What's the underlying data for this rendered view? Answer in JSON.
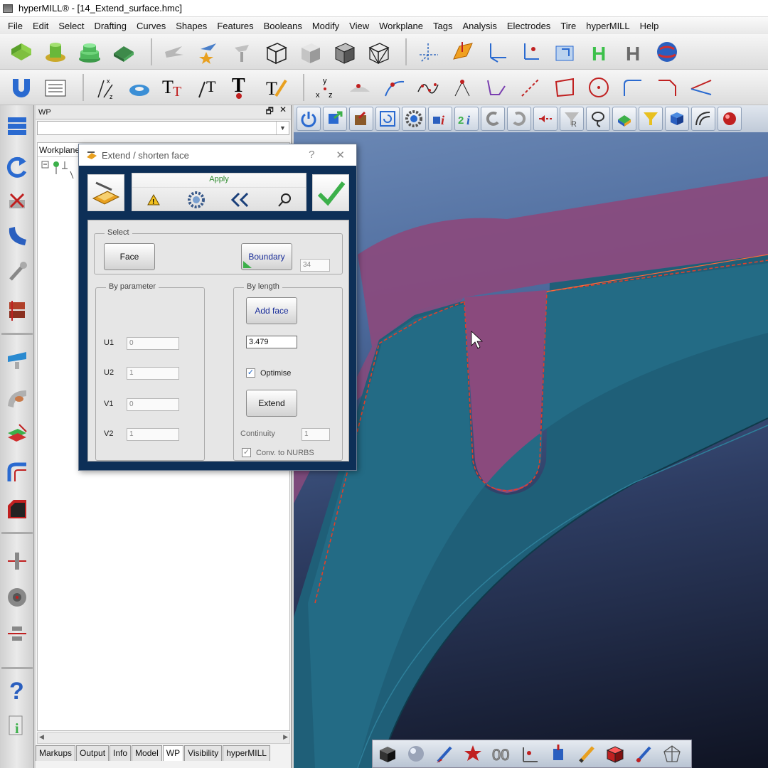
{
  "window": {
    "title": "hyperMILL® - [14_Extend_surface.hmc]"
  },
  "menu": [
    "File",
    "Edit",
    "Select",
    "Drafting",
    "Curves",
    "Shapes",
    "Features",
    "Booleans",
    "Modify",
    "View",
    "Workplane",
    "Tags",
    "Analysis",
    "Electrodes",
    "Tire",
    "hyperMILL",
    "Help"
  ],
  "wp_panel": {
    "title": "WP",
    "float_glyph": "🗗",
    "close_glyph": "✕",
    "tree_header": "Workplane",
    "tabs": [
      "Markups",
      "Output",
      "Info",
      "Model",
      "WP",
      "Visibility",
      "hyperMILL"
    ],
    "active_tab": "WP"
  },
  "dialog": {
    "title": "Extend / shorten face",
    "help": "?",
    "close": "✕",
    "apply_label": "Apply",
    "select_group": "Select",
    "face_button": "Face",
    "boundary_button": "Boundary",
    "boundary_count": "34",
    "by_parameter_group": "By parameter",
    "params": [
      {
        "label": "U1",
        "value": "0"
      },
      {
        "label": "U2",
        "value": "1"
      },
      {
        "label": "V1",
        "value": "0"
      },
      {
        "label": "V2",
        "value": "1"
      }
    ],
    "by_length_group": "By length",
    "add_face_button": "Add face",
    "length_value": "3.479",
    "optimise_label": "Optimise",
    "optimise_checked": true,
    "extend_button": "Extend",
    "continuity_label": "Continuity",
    "continuity_value": "1",
    "nurbs_label": "Conv. to NURBS",
    "nurbs_checked": true
  },
  "colors": {
    "viewport_blue": "#4c6a9c",
    "surface_teal": "#1f5f78",
    "surface_purple": "#8a4a7d",
    "dialog_frame": "#0d2f57",
    "edge_red": "#e0402a"
  }
}
